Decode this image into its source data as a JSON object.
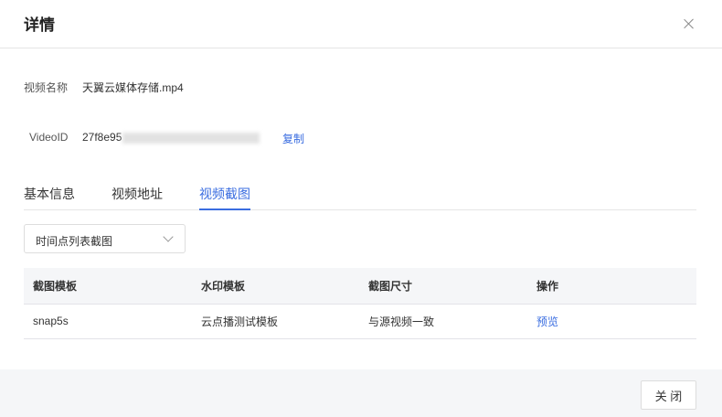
{
  "header": {
    "title": "详情"
  },
  "info": {
    "name_label": "视频名称",
    "name_value": "天翼云媒体存储.mp4",
    "id_label": "VideoID",
    "id_value": "27f8e95",
    "copy_label": "复制"
  },
  "tabs": [
    {
      "label": "基本信息"
    },
    {
      "label": "视频地址"
    },
    {
      "label": "视频截图"
    }
  ],
  "select": {
    "value": "时间点列表截图"
  },
  "table": {
    "headers": [
      "截图模板",
      "水印模板",
      "截图尺寸",
      "操作"
    ],
    "rows": [
      [
        "snap5s",
        "云点播测试模板",
        "与源视频一致",
        "预览"
      ]
    ]
  },
  "footer": {
    "close_label": "关 闭"
  }
}
